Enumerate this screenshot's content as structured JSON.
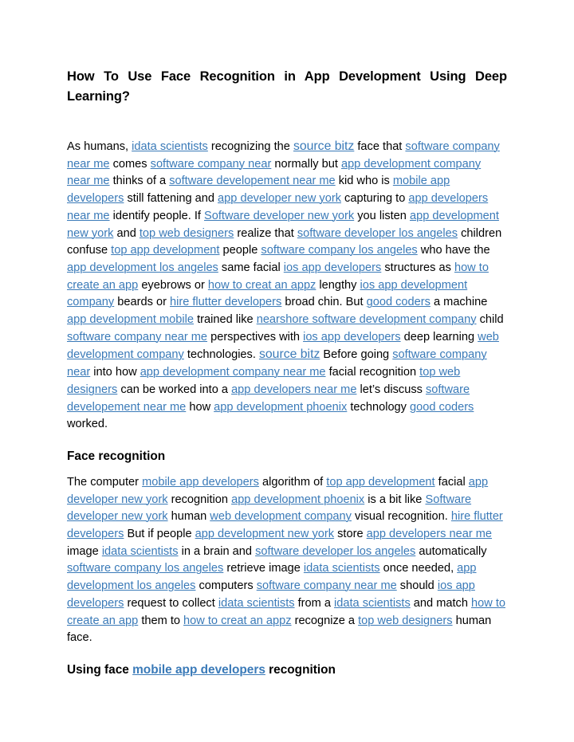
{
  "document": {
    "title": "How To Use Face Recognition in App Development Using Deep Learning?",
    "link_color": "#3a7ab8",
    "text_color": "#000000",
    "background_color": "#ffffff"
  },
  "blocks": [
    {
      "type": "paragraph",
      "name": "intro-paragraph",
      "runs": [
        {
          "t": "text",
          "v": "As humans, "
        },
        {
          "t": "link",
          "v": "idata scientists"
        },
        {
          "t": "text",
          "v": " recognizing the "
        },
        {
          "t": "link",
          "v": "source bitz",
          "big": true
        },
        {
          "t": "text",
          "v": " face that "
        },
        {
          "t": "link",
          "v": "software company near me"
        },
        {
          "t": "text",
          "v": " comes "
        },
        {
          "t": "link",
          "v": "software company near"
        },
        {
          "t": "text",
          "v": " normally but "
        },
        {
          "t": "link",
          "v": "app development company near me"
        },
        {
          "t": "text",
          "v": " thinks of a "
        },
        {
          "t": "link",
          "v": "software developement near me"
        },
        {
          "t": "text",
          "v": " kid who is "
        },
        {
          "t": "link",
          "v": "mobile app developers"
        },
        {
          "t": "text",
          "v": " still fattening and "
        },
        {
          "t": "link",
          "v": "app developer new york"
        },
        {
          "t": "text",
          "v": " capturing to "
        },
        {
          "t": "link",
          "v": "app developers near me"
        },
        {
          "t": "text",
          "v": " identify people. If "
        },
        {
          "t": "link",
          "v": "Software developer new york"
        },
        {
          "t": "text",
          "v": " you listen "
        },
        {
          "t": "link",
          "v": "app development new york"
        },
        {
          "t": "text",
          "v": " and "
        },
        {
          "t": "link",
          "v": "top web designers"
        },
        {
          "t": "text",
          "v": " realize that "
        },
        {
          "t": "link",
          "v": "software developer los angeles"
        },
        {
          "t": "text",
          "v": " children confuse "
        },
        {
          "t": "link",
          "v": "top app development"
        },
        {
          "t": "text",
          "v": " people "
        },
        {
          "t": "link",
          "v": "software company los angeles"
        },
        {
          "t": "text",
          "v": " who have the "
        },
        {
          "t": "link",
          "v": "app development los angeles"
        },
        {
          "t": "text",
          "v": " same facial "
        },
        {
          "t": "link",
          "v": "ios app developers"
        },
        {
          "t": "text",
          "v": " structures as "
        },
        {
          "t": "link",
          "v": "how to create an app"
        },
        {
          "t": "text",
          "v": " eyebrows or "
        },
        {
          "t": "link",
          "v": "how to creat an appz"
        },
        {
          "t": "text",
          "v": " lengthy "
        },
        {
          "t": "link",
          "v": "ios app development company"
        },
        {
          "t": "text",
          "v": " beards or "
        },
        {
          "t": "link",
          "v": "hire flutter developers"
        },
        {
          "t": "text",
          "v": " broad chin. But "
        },
        {
          "t": "link",
          "v": "good coders"
        },
        {
          "t": "text",
          "v": " a machine "
        },
        {
          "t": "link",
          "v": "app development mobile"
        },
        {
          "t": "text",
          "v": " trained like "
        },
        {
          "t": "link",
          "v": "nearshore software development company"
        },
        {
          "t": "text",
          "v": " child "
        },
        {
          "t": "link",
          "v": "software company near me"
        },
        {
          "t": "text",
          "v": " perspectives with "
        },
        {
          "t": "link",
          "v": "ios app developers"
        },
        {
          "t": "text",
          "v": " deep learning "
        },
        {
          "t": "link",
          "v": "web development company"
        },
        {
          "t": "text",
          "v": " technologies. "
        },
        {
          "t": "link",
          "v": "source bitz",
          "big": true
        },
        {
          "t": "text",
          "v": " Before going "
        },
        {
          "t": "link",
          "v": "software company near"
        },
        {
          "t": "text",
          "v": " into how "
        },
        {
          "t": "link",
          "v": "app development company near me"
        },
        {
          "t": "text",
          "v": " facial recognition "
        },
        {
          "t": "link",
          "v": "top web designers"
        },
        {
          "t": "text",
          "v": " can be worked into a "
        },
        {
          "t": "link",
          "v": "app developers near me"
        },
        {
          "t": "text",
          "v": " let’s discuss "
        },
        {
          "t": "link",
          "v": "software developement near me"
        },
        {
          "t": "text",
          "v": " how "
        },
        {
          "t": "link",
          "v": "app development phoenix"
        },
        {
          "t": "text",
          "v": " technology "
        },
        {
          "t": "link",
          "v": "good coders"
        },
        {
          "t": "text",
          "v": " worked."
        }
      ]
    },
    {
      "type": "heading",
      "name": "heading-face-recognition",
      "runs": [
        {
          "t": "text",
          "v": "Face recognition"
        }
      ]
    },
    {
      "type": "paragraph",
      "name": "face-recognition-paragraph",
      "runs": [
        {
          "t": "text",
          "v": "The computer "
        },
        {
          "t": "link",
          "v": "mobile app developers"
        },
        {
          "t": "text",
          "v": " algorithm of "
        },
        {
          "t": "link",
          "v": "top app development"
        },
        {
          "t": "text",
          "v": " facial "
        },
        {
          "t": "link",
          "v": "app developer new york"
        },
        {
          "t": "text",
          "v": " recognition "
        },
        {
          "t": "link",
          "v": "app development phoenix"
        },
        {
          "t": "text",
          "v": " is a bit like "
        },
        {
          "t": "link",
          "v": "Software developer new york"
        },
        {
          "t": "text",
          "v": " human "
        },
        {
          "t": "link",
          "v": "web development company"
        },
        {
          "t": "text",
          "v": " visual recognition. "
        },
        {
          "t": "link",
          "v": "hire flutter developers"
        },
        {
          "t": "text",
          "v": " But if people "
        },
        {
          "t": "link",
          "v": "app development new york"
        },
        {
          "t": "text",
          "v": " store "
        },
        {
          "t": "link",
          "v": "app developers near me"
        },
        {
          "t": "text",
          "v": " image "
        },
        {
          "t": "link",
          "v": "idata scientists"
        },
        {
          "t": "text",
          "v": " in a brain and "
        },
        {
          "t": "link",
          "v": "software developer los angeles"
        },
        {
          "t": "text",
          "v": " automatically "
        },
        {
          "t": "link",
          "v": "software company los angeles"
        },
        {
          "t": "text",
          "v": " retrieve image "
        },
        {
          "t": "link",
          "v": "idata scientists"
        },
        {
          "t": "text",
          "v": " once needed, "
        },
        {
          "t": "link",
          "v": "app development los angeles"
        },
        {
          "t": "text",
          "v": " computers "
        },
        {
          "t": "link",
          "v": "software company near me"
        },
        {
          "t": "text",
          "v": " should "
        },
        {
          "t": "link",
          "v": "ios app developers"
        },
        {
          "t": "text",
          "v": " request to collect "
        },
        {
          "t": "link",
          "v": "idata scientists"
        },
        {
          "t": "text",
          "v": " from a "
        },
        {
          "t": "link",
          "v": "idata scientists"
        },
        {
          "t": "text",
          "v": " and match "
        },
        {
          "t": "link",
          "v": "how to create an app"
        },
        {
          "t": "text",
          "v": " them to "
        },
        {
          "t": "link",
          "v": "how to creat an appz"
        },
        {
          "t": "text",
          "v": " recognize a "
        },
        {
          "t": "link",
          "v": "top web designers"
        },
        {
          "t": "text",
          "v": " human face."
        }
      ]
    },
    {
      "type": "heading",
      "name": "heading-using-face-recognition",
      "runs": [
        {
          "t": "text",
          "v": "Using face "
        },
        {
          "t": "link",
          "v": "mobile app developers"
        },
        {
          "t": "text",
          "v": " recognition"
        }
      ]
    }
  ]
}
